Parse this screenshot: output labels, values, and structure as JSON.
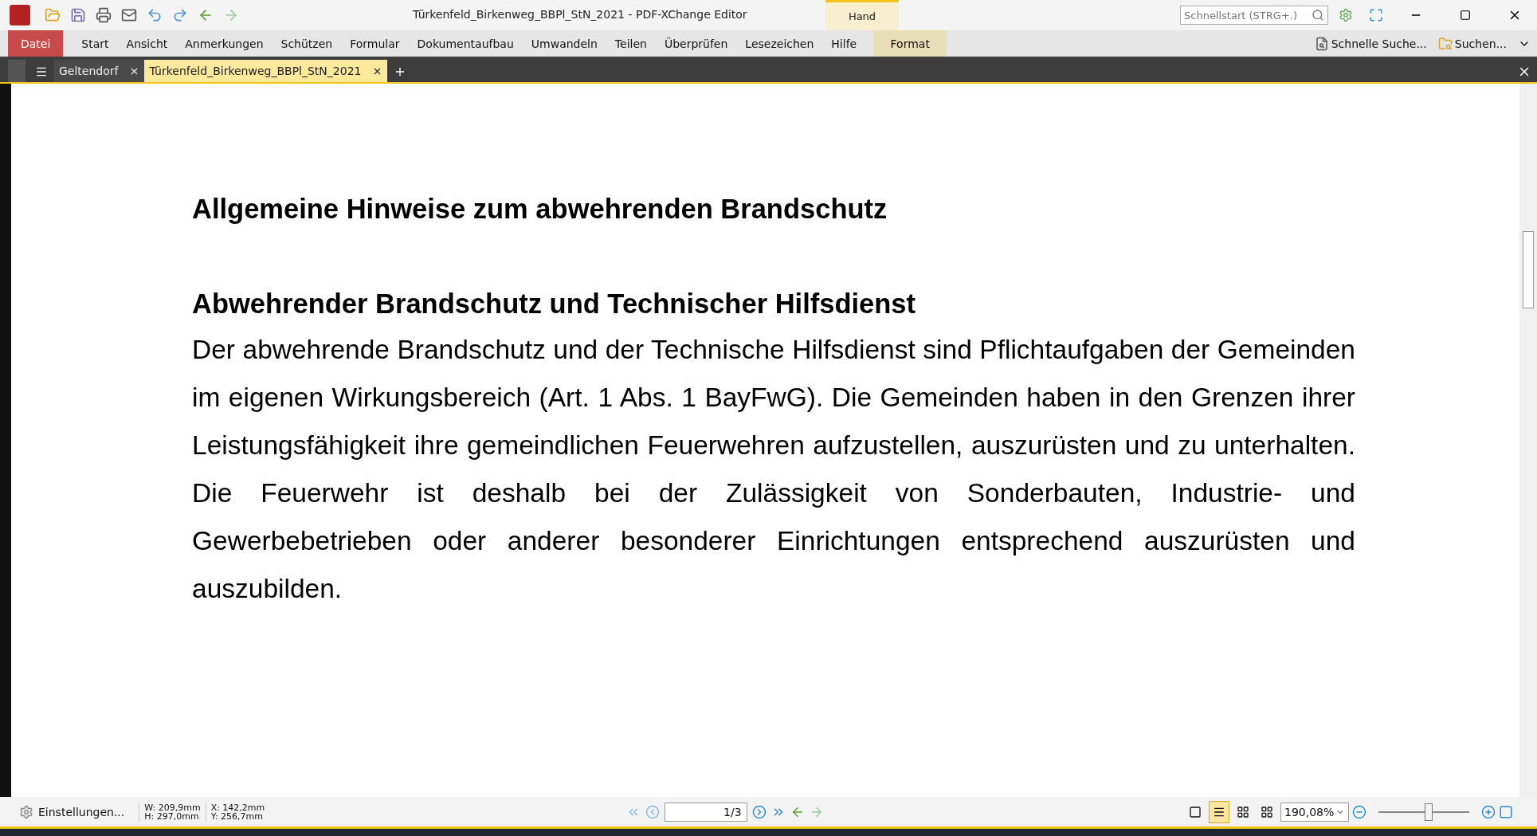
{
  "window": {
    "title": "Türkenfeld_Birkenweg_BBPl_StN_2021 - PDF-XChange Editor",
    "search_placeholder": "Schnellstart (STRG+.)"
  },
  "context_tab": {
    "group": "Hand",
    "label": "Format"
  },
  "menu": [
    {
      "label": "Datei",
      "kind": "file"
    },
    {
      "label": "Start",
      "kind": "menu"
    },
    {
      "label": "Ansicht",
      "kind": "menu"
    },
    {
      "label": "Anmerkungen",
      "kind": "menu"
    },
    {
      "label": "Schützen",
      "kind": "menu"
    },
    {
      "label": "Formular",
      "kind": "menu"
    },
    {
      "label": "Dokumentaufbau",
      "kind": "menu"
    },
    {
      "label": "Umwandeln",
      "kind": "menu"
    },
    {
      "label": "Teilen",
      "kind": "menu"
    },
    {
      "label": "Überprüfen",
      "kind": "menu"
    },
    {
      "label": "Lesezeichen",
      "kind": "menu"
    },
    {
      "label": "Hilfe",
      "kind": "menu"
    }
  ],
  "quick_actions": [
    "Schnelle Suche...",
    "Suchen..."
  ],
  "tabs": [
    {
      "label": "Geltendorf",
      "selected": false
    },
    {
      "label": "Türkenfeld_Birkenweg_BBPl_StN_2021",
      "selected": true
    }
  ],
  "document": {
    "heading": "Allgemeine Hinweise zum abwehrenden Brandschutz",
    "subheading": "Abwehrender Brandschutz und Technischer Hilfsdienst",
    "paragraph": "Der abwehrende Brandschutz und der Technische Hilfsdienst sind Pflichtaufgaben der Gemeinden im eigenen Wirkungsbereich (Art. 1 Abs. 1 BayFwG). Die Gemeinden haben in den Grenzen ihrer Leistungsfähigkeit ihre gemeindlichen Feuerwehren aufzustellen, auszurüsten und zu unterhalten. Die Feuerwehr ist deshalb bei der Zulässigkeit von Sonderbauten, Industrie- und Gewerbebetrieben oder anderer besonderer Einrichtungen entsprechend auszurüsten und auszubilden."
  },
  "status_bar": {
    "settings": "Einstellungen...",
    "width": "W: 209,9mm",
    "height": "H: 297,0mm",
    "x": "X: 142,2mm",
    "y": "Y: 256,7mm",
    "page": "1",
    "page_total": "/3",
    "zoom": "190,08%",
    "zoom_level": {
      "level": 0.55
    },
    "view_modes": [
      {
        "kind": "single",
        "selected": false
      },
      {
        "kind": "continuous",
        "selected": true
      },
      {
        "kind": "facing",
        "selected": false
      },
      {
        "kind": "facing-continuous",
        "selected": false
      }
    ]
  }
}
